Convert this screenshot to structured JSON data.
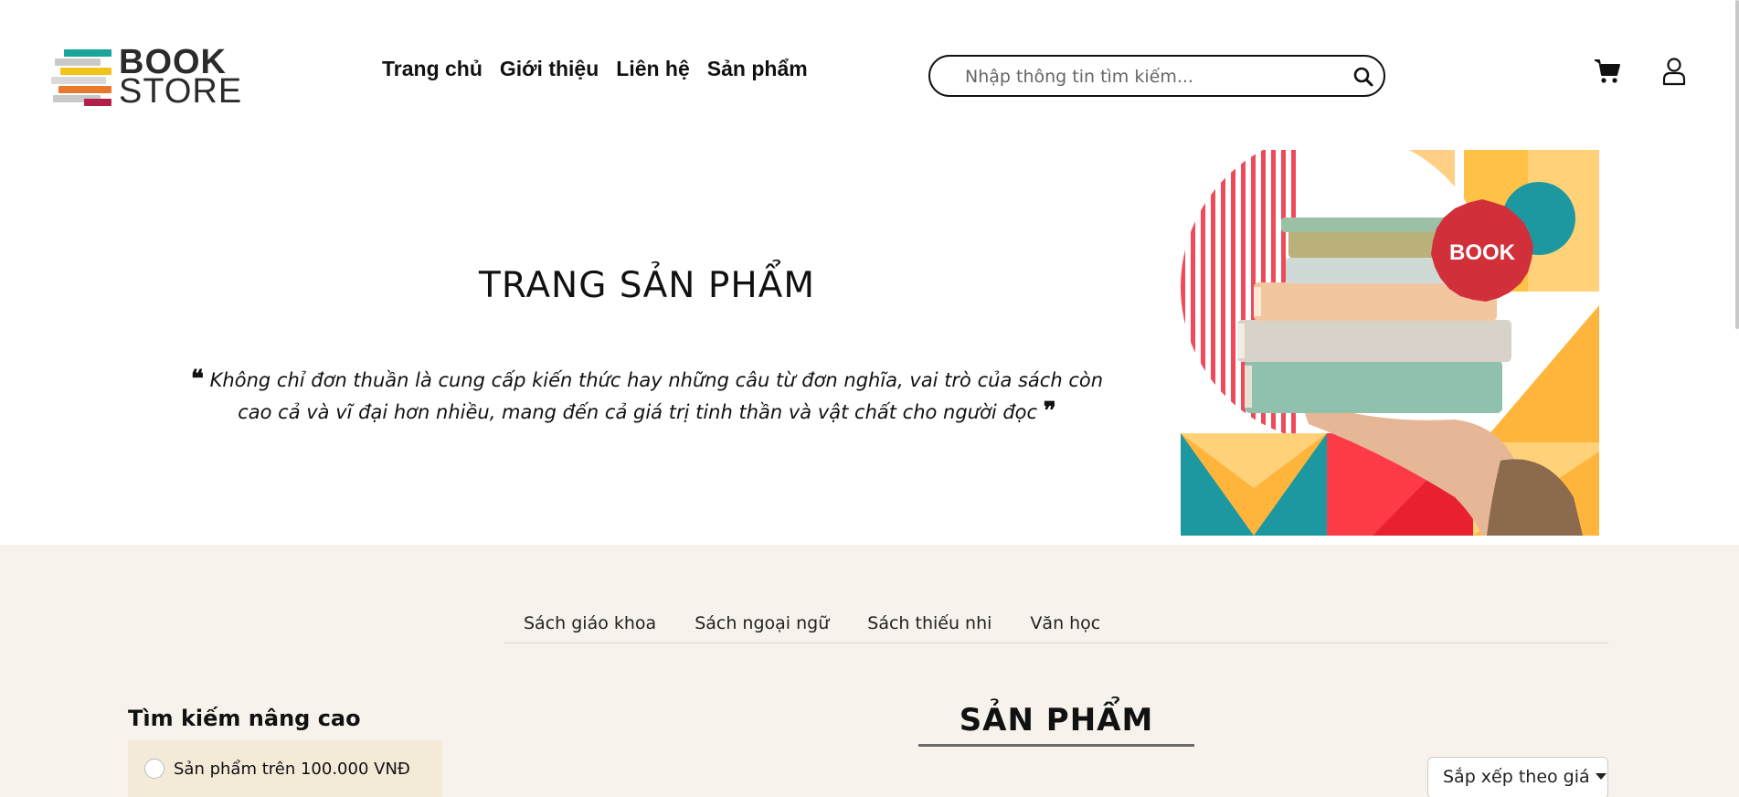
{
  "brand": {
    "line1": "BOOK",
    "line2": "STORE"
  },
  "nav": [
    {
      "label": "Trang chủ"
    },
    {
      "label": "Giới thiệu"
    },
    {
      "label": "Liên hệ"
    },
    {
      "label": "Sản phẩm"
    }
  ],
  "search": {
    "placeholder": "Nhập thông tin tìm kiếm...",
    "value": ""
  },
  "icons": {
    "search": "search-icon",
    "cart": "cart-icon",
    "user": "user-icon",
    "quote_open": "quote-open-icon",
    "quote_close": "quote-close-icon"
  },
  "hero": {
    "title": "TRANG SẢN PHẨM",
    "quote": "Không chỉ đơn thuần là cung cấp kiến thức hay những câu từ đơn nghĩa, vai trò của sách còn cao cả và vĩ đại hơn nhiều, mang đến cả giá trị tinh thần và vật chất cho người đọc",
    "badge": "BOOK"
  },
  "categories": [
    {
      "label": "Sách giáo khoa"
    },
    {
      "label": "Sách ngoại ngữ"
    },
    {
      "label": "Sách thiếu nhi"
    },
    {
      "label": "Văn học"
    }
  ],
  "advanced_search": {
    "title": "Tìm kiếm nâng cao",
    "options": [
      {
        "label": "Sản phẩm trên 100.000 VNĐ",
        "checked": false
      }
    ]
  },
  "products": {
    "title": "SẢN PHẨM",
    "sort_label": "Sắp xếp theo giá"
  },
  "colors": {
    "catalog_bg": "#f7f3ec",
    "filter_bg": "#f4ead8",
    "badge_red": "#d1303b"
  }
}
